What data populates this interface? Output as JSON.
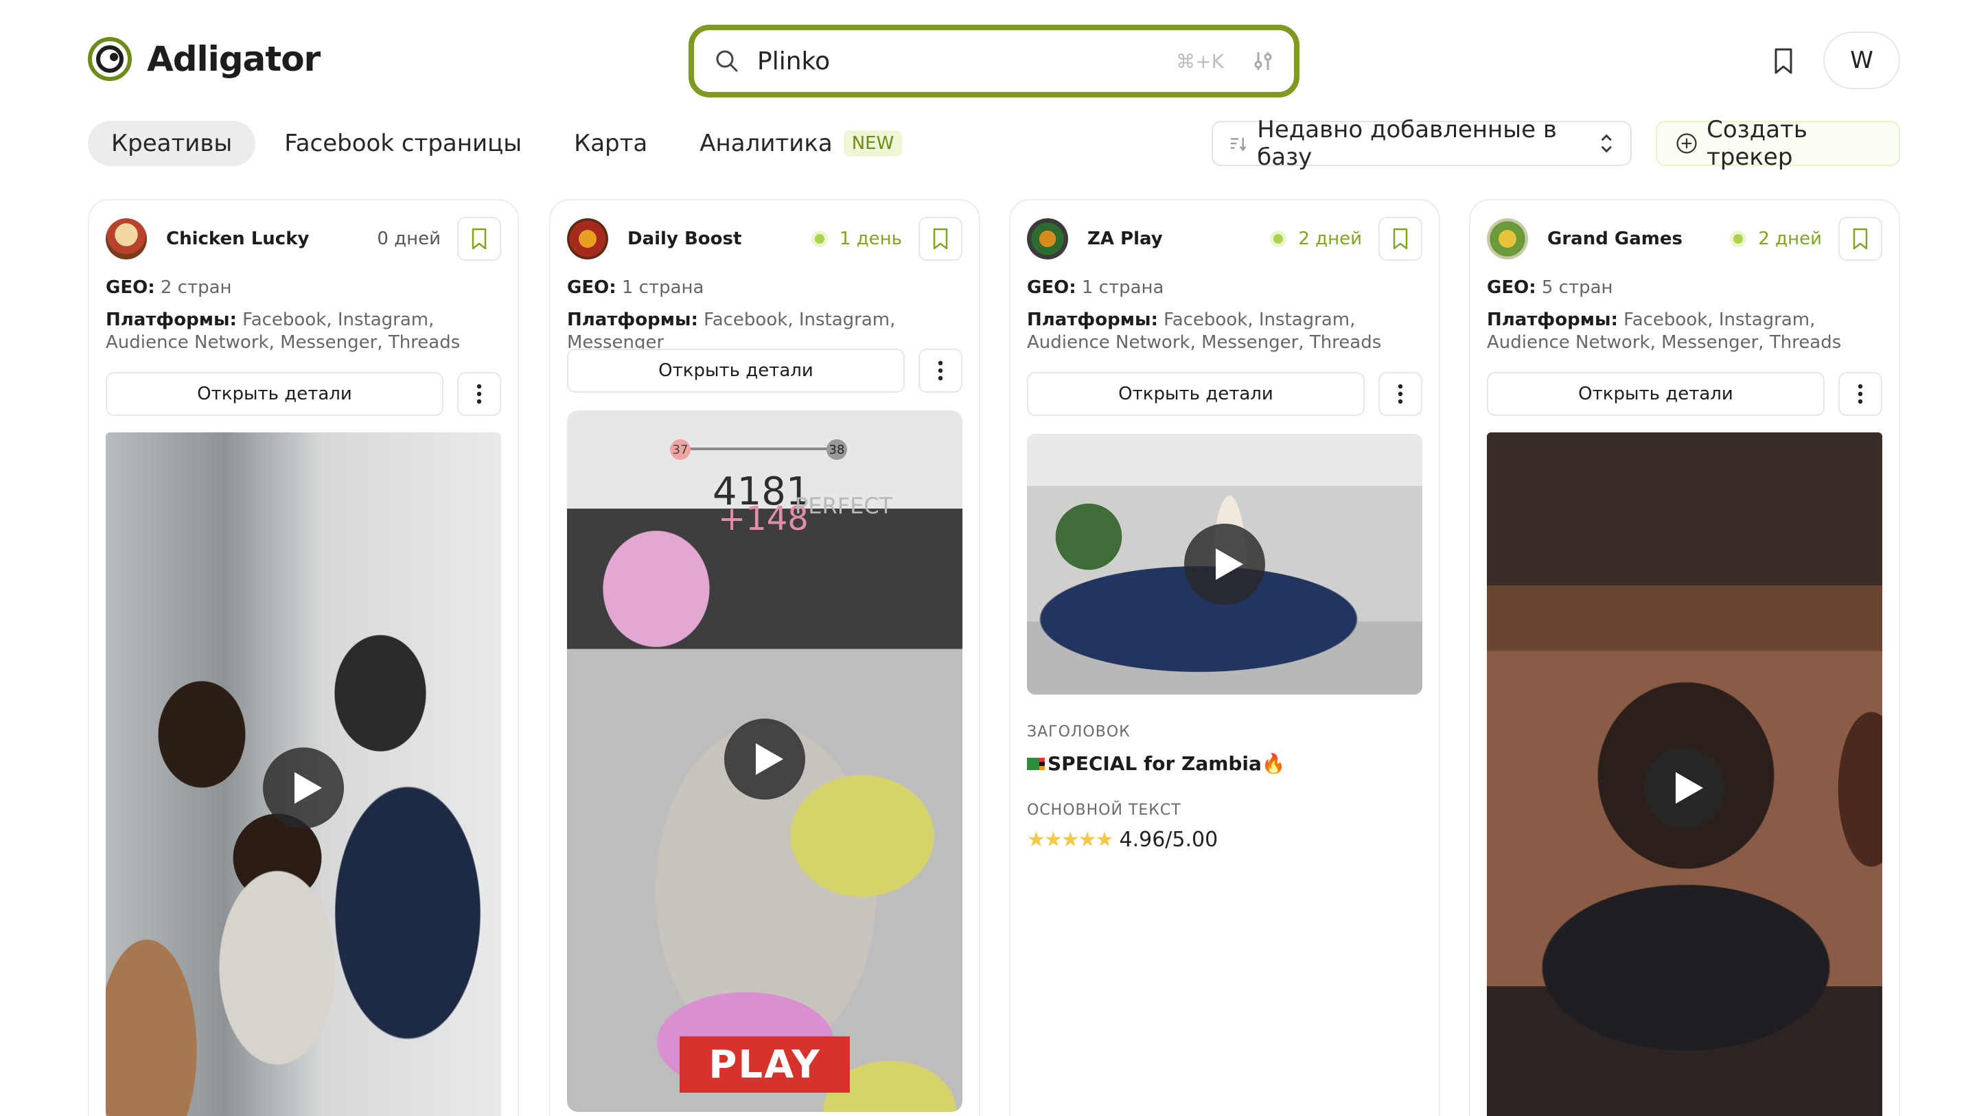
{
  "brand": {
    "name": "Adligator"
  },
  "search": {
    "value": "Plinko",
    "shortcut": "⌘+K"
  },
  "header": {
    "avatar_letter": "W"
  },
  "nav": {
    "tabs": [
      {
        "label": "Креативы",
        "active": true
      },
      {
        "label": "Facebook страницы"
      },
      {
        "label": "Карта"
      },
      {
        "label": "Аналитика",
        "badge": "NEW"
      }
    ]
  },
  "sort": {
    "label": "Недавно добавленные в базу"
  },
  "create_tracker": {
    "label": "Создать трекер"
  },
  "cards": [
    {
      "name": "Chicken Lucky",
      "days": "0 дней",
      "geo_label": "GEO:",
      "geo_value": "2 стран",
      "platforms_label": "Платформы:",
      "platforms_value": "Facebook, Instagram, Audience Network, Messenger, Threads",
      "open_label": "Открыть детали"
    },
    {
      "name": "Daily Boost",
      "days": "1 день",
      "geo_label": "GEO:",
      "geo_value": "1 страна",
      "platforms_label": "Платформы:",
      "platforms_value": "Facebook, Instagram, Messenger",
      "open_label": "Открыть детали",
      "media_text": {
        "score_left": "37",
        "score_right": "38",
        "score": "4181",
        "bonus": "+148",
        "perfect": "PERFECT",
        "cta": "PLAY"
      }
    },
    {
      "name": "ZA Play",
      "days": "2 дней",
      "geo_label": "GEO:",
      "geo_value": "1 страна",
      "platforms_label": "Платформы:",
      "platforms_value": "Facebook, Instagram, Audience Network, Messenger, Threads",
      "open_label": "Открыть детали",
      "headline_label": "ЗАГОЛОВОК",
      "headline": "SPECIAL for Zambia🔥",
      "body_label": "ОСНОВНОЙ ТЕКСТ",
      "rating": "4.96/5.00",
      "stars": "★★★★★"
    },
    {
      "name": "Grand Games",
      "days": "2 дней",
      "geo_label": "GEO:",
      "geo_value": "5 стран",
      "platforms_label": "Платформы:",
      "platforms_value": "Facebook, Instagram, Audience Network, Messenger, Threads",
      "open_label": "Открыть детали"
    }
  ],
  "colors": {
    "accent": "#7f9a1e",
    "badge_green": "#7fa51f",
    "new_badge_bg": "#eef6d6"
  }
}
